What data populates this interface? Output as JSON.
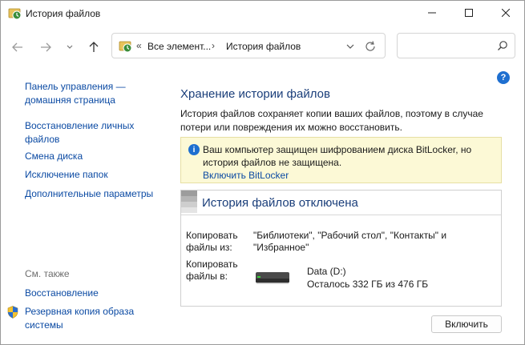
{
  "window": {
    "title": "История файлов"
  },
  "address_bar": {
    "prefix_chevrons": "«",
    "crumbs": [
      "Все элемент...",
      "История файлов"
    ],
    "separator": "›"
  },
  "search": {
    "placeholder": ""
  },
  "sidebar": {
    "links": [
      "Панель управления — домашняя страница",
      "Восстановление личных файлов",
      "Смена диска",
      "Исключение папок",
      "Дополнительные параметры"
    ],
    "see_also_label": "См. также",
    "see_also_links": [
      "Восстановление",
      "Резервная копия образа системы"
    ]
  },
  "main": {
    "title": "Хранение истории файлов",
    "description": "История файлов сохраняет копии ваших файлов, поэтому в случае потери или повреждения их можно восстановить.",
    "notice": {
      "text": "Ваш компьютер защищен шифрованием диска BitLocker, но история файлов не защищена.",
      "link": "Включить BitLocker"
    },
    "status": {
      "header": "История файлов отключена",
      "copy_from_label": "Копировать файлы из:",
      "copy_from_value": "\"Библиотеки\", \"Рабочий стол\", \"Контакты\" и \"Избранное\"",
      "copy_to_label": "Копировать файлы в:",
      "drive_name": "Data (D:)",
      "drive_free": "Осталось 332 ГБ из 476 ГБ"
    },
    "enable_button": "Включить"
  },
  "colors": {
    "link": "#0b4aa3",
    "heading": "#1a3e7a",
    "notice_bg": "#fcf9d6",
    "accent_blue": "#1e6fd0"
  }
}
